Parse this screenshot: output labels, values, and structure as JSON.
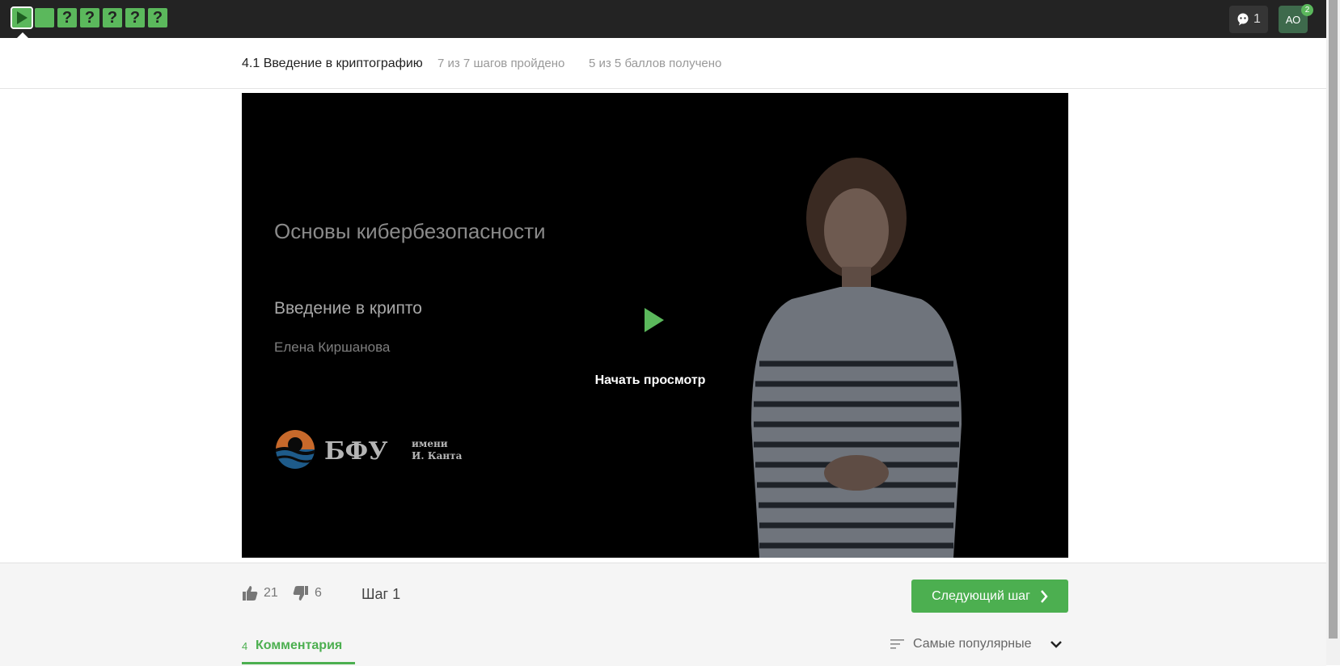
{
  "topbar": {
    "steps": [
      {
        "type": "video",
        "state": "done",
        "label": ""
      },
      {
        "type": "text",
        "state": "done",
        "label": ""
      },
      {
        "type": "quiz",
        "state": "done",
        "label": "?"
      },
      {
        "type": "quiz",
        "state": "done",
        "label": "?"
      },
      {
        "type": "quiz",
        "state": "done",
        "label": "?"
      },
      {
        "type": "quiz",
        "state": "done",
        "label": "?"
      },
      {
        "type": "quiz",
        "state": "done",
        "label": "?"
      }
    ],
    "notifications_count": "1",
    "avatar_initials": "АО",
    "avatar_badge": "2"
  },
  "lesson": {
    "title": "4.1 Введение в криптографию",
    "progress": "7 из 7 шагов пройдено",
    "score": "5 из 5 баллов  получено"
  },
  "video": {
    "course_title": "Основы кибербезопасности",
    "topic": "Введение в крипто",
    "author": "Елена Киршанова",
    "logo_text": "БФУ",
    "logo_sub1": "имени",
    "logo_sub2": "И. Канта",
    "play_label": "Начать просмотр"
  },
  "footer": {
    "likes": "21",
    "dislikes": "6",
    "step_label": "Шаг 1",
    "next_button": "Следующий шаг",
    "comments_count": "4",
    "comments_label": "Комментария",
    "sort_label": "Самые популярные"
  },
  "colors": {
    "accent": "#4caf50",
    "step_done": "#5bb85c",
    "topbar": "#232323"
  }
}
